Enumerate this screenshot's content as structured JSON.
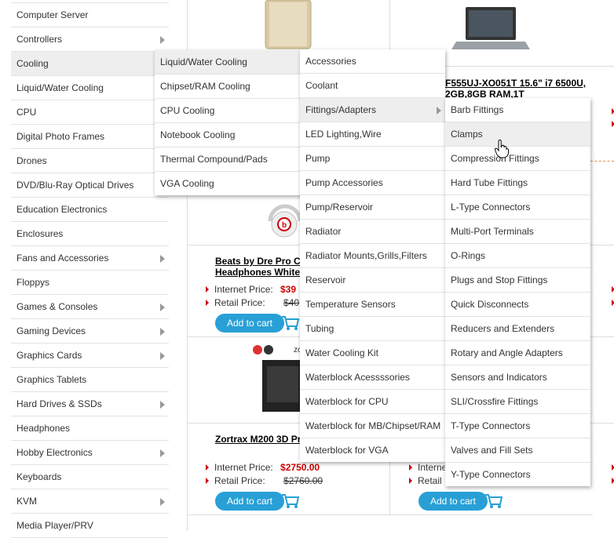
{
  "categories": [
    {
      "label": "Computer Server",
      "has_sub": false
    },
    {
      "label": "Controllers",
      "has_sub": true
    },
    {
      "label": "Cooling",
      "has_sub": false,
      "active": true
    },
    {
      "label": "Liquid/Water Cooling",
      "has_sub": false
    },
    {
      "label": "CPU",
      "has_sub": false
    },
    {
      "label": "Digital Photo Frames",
      "has_sub": false
    },
    {
      "label": "Drones",
      "has_sub": false
    },
    {
      "label": "DVD/Blu-Ray Optical Drives",
      "has_sub": false
    },
    {
      "label": "Education Electronics",
      "has_sub": false
    },
    {
      "label": "Enclosures",
      "has_sub": false
    },
    {
      "label": "Fans and Accessories",
      "has_sub": true
    },
    {
      "label": "Floppys",
      "has_sub": false
    },
    {
      "label": "Games & Consoles",
      "has_sub": true
    },
    {
      "label": "Gaming Devices",
      "has_sub": true
    },
    {
      "label": "Graphics Cards",
      "has_sub": true
    },
    {
      "label": "Graphics Tablets",
      "has_sub": false
    },
    {
      "label": "Hard Drives & SSDs",
      "has_sub": true
    },
    {
      "label": "Headphones",
      "has_sub": false
    },
    {
      "label": "Hobby Electronics",
      "has_sub": true
    },
    {
      "label": "Keyboards",
      "has_sub": false
    },
    {
      "label": "KVM",
      "has_sub": true
    },
    {
      "label": "Media Player/PRV",
      "has_sub": false
    }
  ],
  "menu_cooling": [
    {
      "label": "Liquid/Water Cooling",
      "active": true
    },
    {
      "label": "Chipset/RAM Cooling"
    },
    {
      "label": "CPU Cooling"
    },
    {
      "label": "Notebook Cooling"
    },
    {
      "label": "Thermal Compound/Pads"
    },
    {
      "label": "VGA Cooling"
    }
  ],
  "menu_liquid": [
    {
      "label": "Accessories"
    },
    {
      "label": "Coolant"
    },
    {
      "label": "Fittings/Adapters",
      "active": true,
      "has_sub": true
    },
    {
      "label": "LED Lighting,Wire"
    },
    {
      "label": "Pump"
    },
    {
      "label": "Pump Accessories"
    },
    {
      "label": "Pump/Reservoir"
    },
    {
      "label": "Radiator"
    },
    {
      "label": "Radiator Mounts,Grills,Filters"
    },
    {
      "label": "Reservoir"
    },
    {
      "label": "Temperature Sensors"
    },
    {
      "label": "Tubing"
    },
    {
      "label": "Water Cooling Kit"
    },
    {
      "label": "Waterblock Acessssories"
    },
    {
      "label": "Waterblock for CPU"
    },
    {
      "label": "Waterblock for MB/Chipset/RAM"
    },
    {
      "label": "Waterblock for VGA"
    }
  ],
  "menu_fittings": [
    {
      "label": "Barb Fittings"
    },
    {
      "label": "Clamps",
      "active": true
    },
    {
      "label": "Compression Fittings"
    },
    {
      "label": "Hard Tube Fittings"
    },
    {
      "label": "L-Type Connectors"
    },
    {
      "label": "Multi-Port Terminals"
    },
    {
      "label": "O-Rings"
    },
    {
      "label": "Plugs and Stop Fittings"
    },
    {
      "label": "Quick Disconnects"
    },
    {
      "label": "Reducers and Extenders"
    },
    {
      "label": "Rotary and Angle Adapters"
    },
    {
      "label": "Sensors and Indicators"
    },
    {
      "label": "SLI/Crossfire Fittings"
    },
    {
      "label": "T-Type Connectors"
    },
    {
      "label": "Valves and Fill Sets"
    },
    {
      "label": "Y-Type Connectors"
    }
  ],
  "products": {
    "laptop_title": "F555UJ-XO051T 15.6\" i7 6500U, 2GB,8GB RAM,1T",
    "beats_title": "Beats by Dre Pro C Headphones White",
    "beats_internet_label": "Internet Price:",
    "beats_internet_price": "$39",
    "beats_retail_label": "Retail Price:",
    "beats_retail_price": "$40",
    "zortrax_title": "Zortrax M200 3D Pr",
    "zortrax_internet_label": "Internet Price:",
    "zortrax_internet_price": "$2750.00",
    "zortrax_retail_label": "Retail Price:",
    "zortrax_retail_price": "$2760.00",
    "right_internet_label": "Interne",
    "right_retail_label": "Retail",
    "add_to_cart": "Add to cart",
    "zortrax_brand": "zo"
  },
  "colors": {
    "accent": "#28a0d6",
    "price_red": "#cc0000",
    "highlight": "#eeeeee"
  }
}
